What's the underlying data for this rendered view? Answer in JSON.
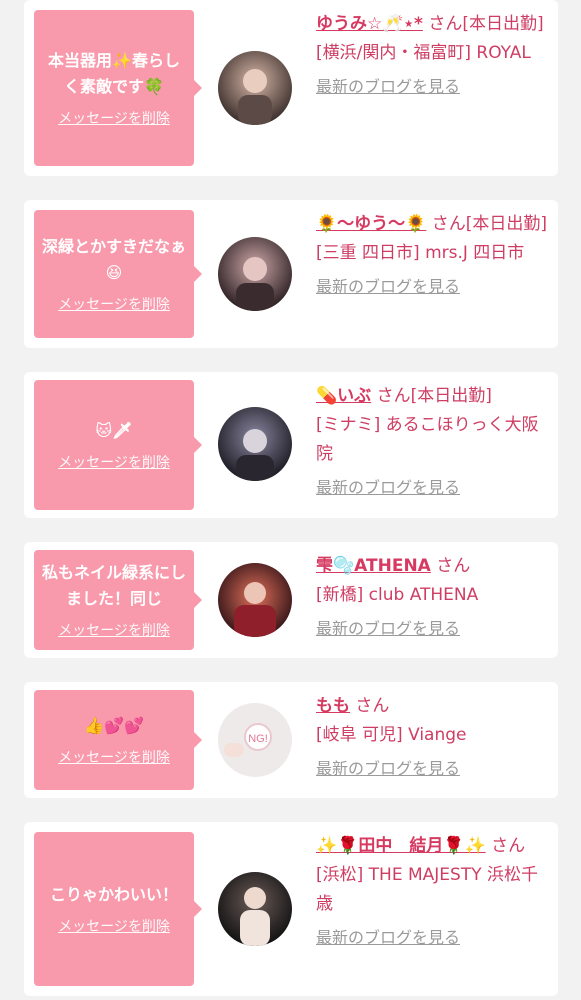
{
  "cards": [
    {
      "message": "本当器用✨春らしく素敵です🍀",
      "delete_label": "メッセージを削除",
      "name": "ゆうみ☆︎🥂⋆*",
      "suffix": "さん",
      "status": "[本日出勤]",
      "shop": "[横浜/関内・福富町] ROYAL",
      "blog_label": "最新のブログを見る",
      "avatar_colors": [
        "#3a2e2b",
        "#c9a99a"
      ]
    },
    {
      "message": "深緑とかすきだなぁ😆",
      "delete_label": "メッセージを削除",
      "name": "🌻〜ゆう〜🌻",
      "suffix": "さん",
      "status": "[本日出勤]",
      "shop": "[三重 四日市] mrs.J 四日市",
      "blog_label": "最新のブログを見る",
      "avatar_colors": [
        "#2b1f22",
        "#b88d8f"
      ]
    },
    {
      "message": "🐱🗡",
      "delete_label": "メッセージを削除",
      "name": "💊いぶ",
      "suffix": "さん",
      "status": "[本日出勤]",
      "shop": "[ミナミ] あるこほりっく大阪院",
      "blog_label": "最新のブログを見る",
      "avatar_colors": [
        "#1b1b22",
        "#6c6880"
      ]
    },
    {
      "message": "私もネイル緑系にしました！同じ",
      "delete_label": "メッセージを削除",
      "name": "雫🫧ATHENA",
      "suffix": "さん",
      "status": "",
      "shop": "[新橋] club ATHENA",
      "blog_label": "最新のブログを見る",
      "avatar_colors": [
        "#2a0f14",
        "#c04a4f"
      ]
    },
    {
      "message": "👍💕💕",
      "delete_label": "メッセージを削除",
      "name": "もも",
      "suffix": "さん",
      "status": "",
      "shop": "[岐阜 可児] Viange",
      "blog_label": "最新のブログを見る",
      "avatar_colors": [
        "#e9e4e4",
        "#ffffff"
      ]
    },
    {
      "message": "こりゃかわいい！",
      "delete_label": "メッセージを削除",
      "name": "✨🌹田中　結月🌹✨",
      "suffix": "さん",
      "status": "",
      "shop": "[浜松] THE MAJESTY 浜松千歳",
      "blog_label": "最新のブログを見る",
      "avatar_colors": [
        "#111111",
        "#e8d8d0"
      ]
    }
  ],
  "colors": {
    "bubble": "#f99aac",
    "name": "#d63a61",
    "text": "#cf3d63",
    "link": "#9a9a9a"
  }
}
